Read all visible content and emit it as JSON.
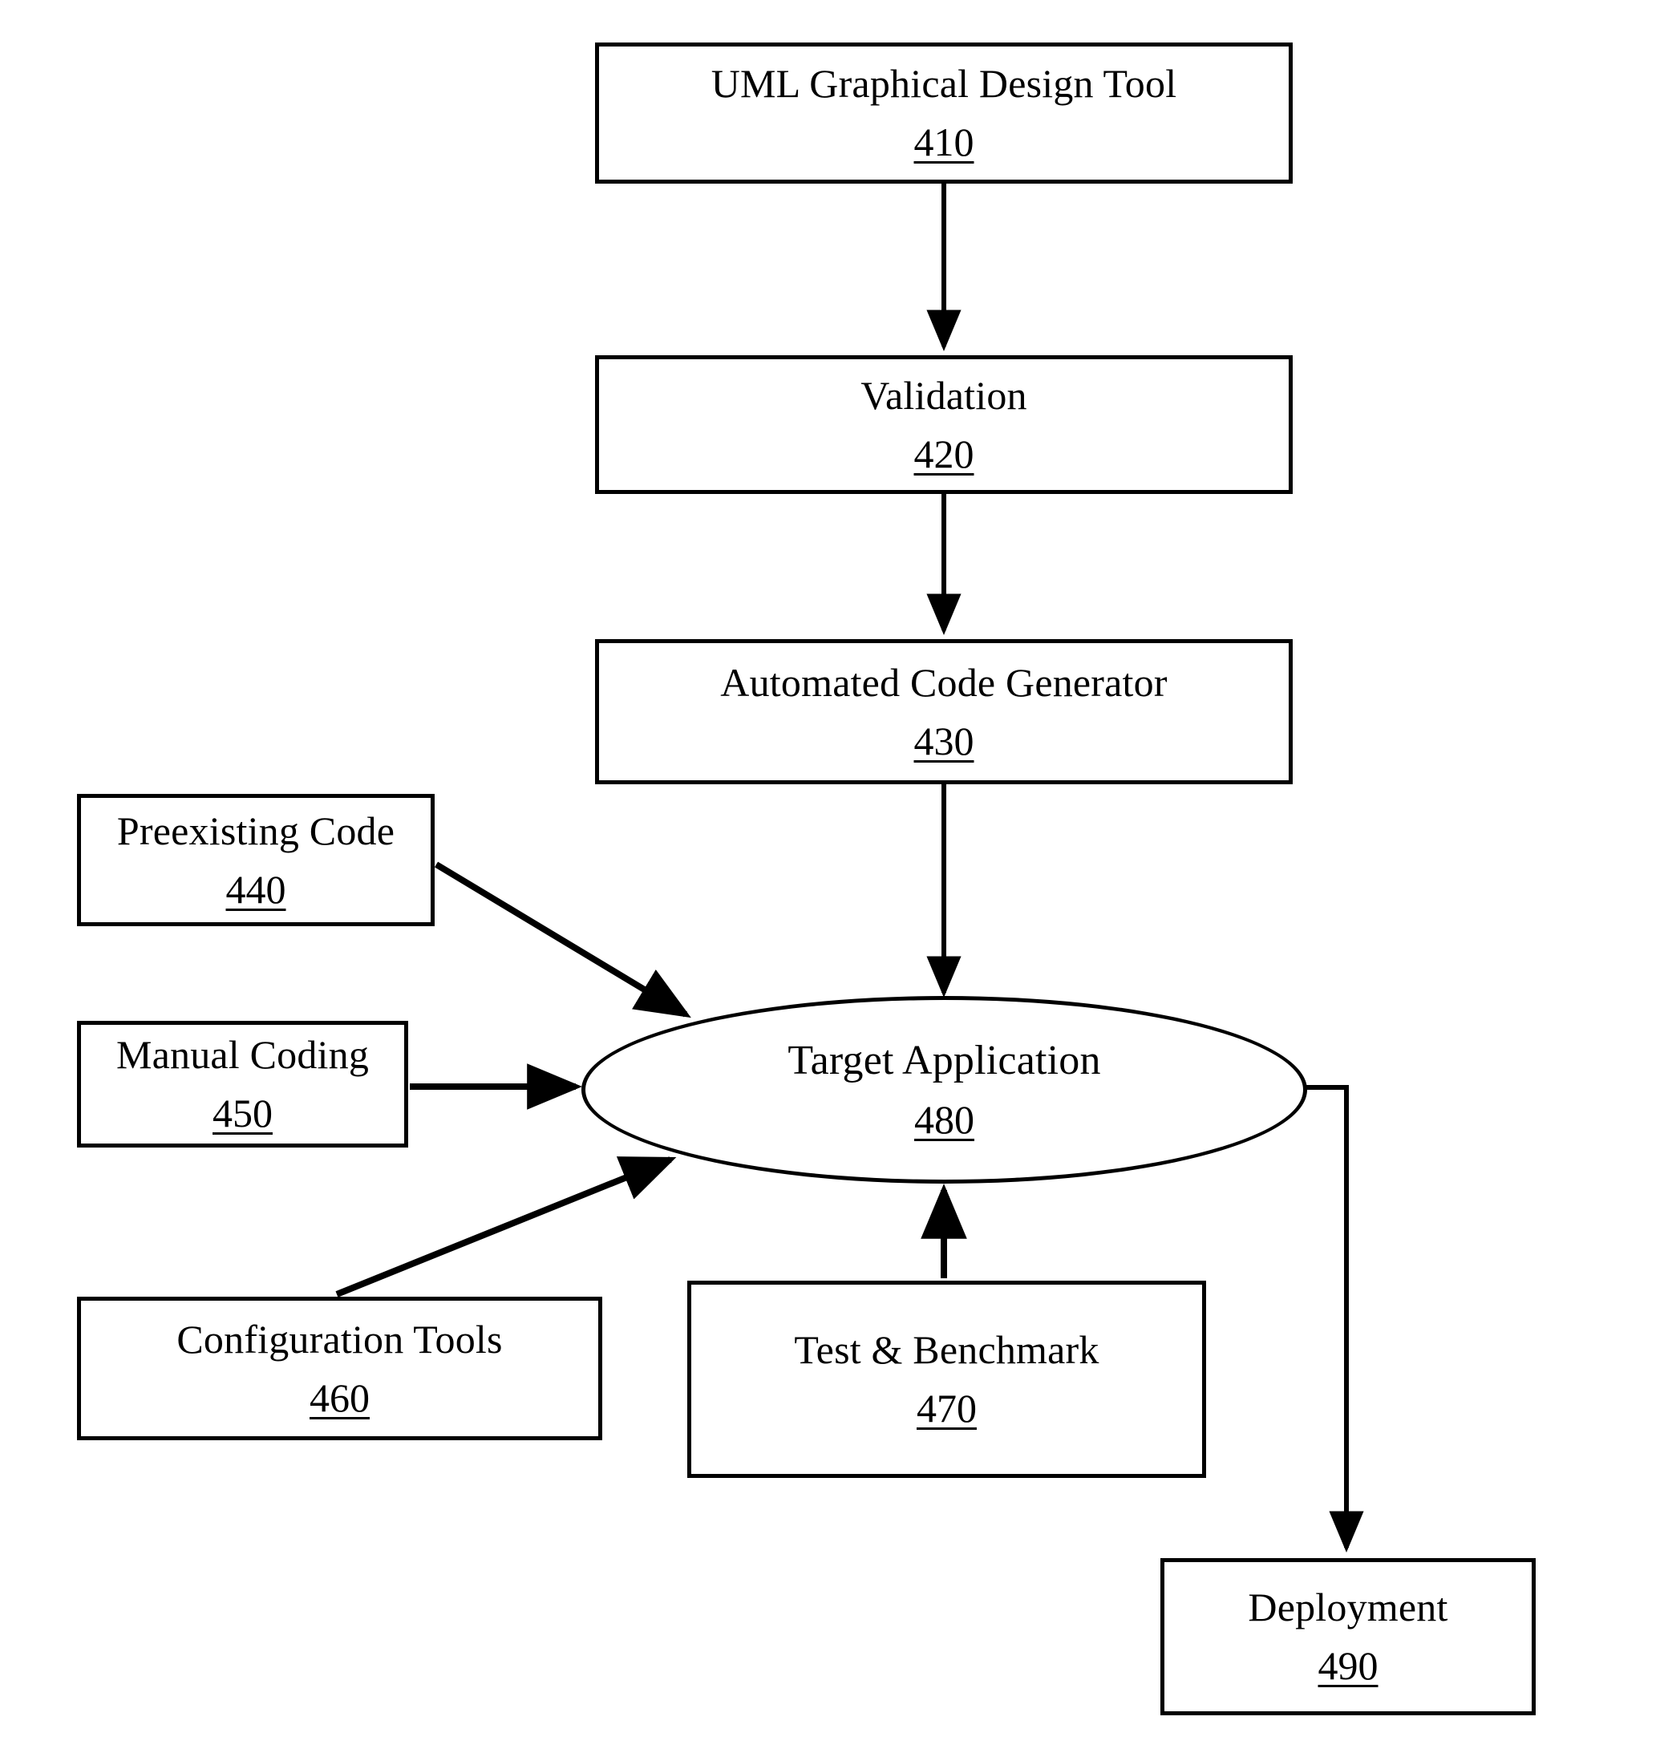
{
  "figure": {
    "title": "Software development toolchain flow diagram",
    "stroke_color": "#000000",
    "background_color": "#ffffff"
  },
  "nodes": [
    {
      "id": "410",
      "label": "UML Graphical Design Tool",
      "ref": "410",
      "shape": "rectangle"
    },
    {
      "id": "420",
      "label": "Validation",
      "ref": "420",
      "shape": "rectangle"
    },
    {
      "id": "430",
      "label": "Automated Code Generator",
      "ref": "430",
      "shape": "rectangle"
    },
    {
      "id": "440",
      "label": "Preexisting Code",
      "ref": "440",
      "shape": "rectangle"
    },
    {
      "id": "450",
      "label": "Manual Coding",
      "ref": "450",
      "shape": "rectangle"
    },
    {
      "id": "460",
      "label": "Configuration Tools",
      "ref": "460",
      "shape": "rectangle"
    },
    {
      "id": "470",
      "label": "Test & Benchmark",
      "ref": "470",
      "shape": "rectangle"
    },
    {
      "id": "480",
      "label": "Target Application",
      "ref": "480",
      "shape": "ellipse"
    },
    {
      "id": "490",
      "label": "Deployment",
      "ref": "490",
      "shape": "rectangle"
    }
  ],
  "edges": [
    {
      "from": "410",
      "to": "420",
      "style": "straight-vertical",
      "arrow": "end"
    },
    {
      "from": "420",
      "to": "430",
      "style": "straight-vertical",
      "arrow": "end"
    },
    {
      "from": "430",
      "to": "480",
      "style": "straight-vertical",
      "arrow": "end"
    },
    {
      "from": "440",
      "to": "480",
      "style": "diagonal",
      "arrow": "end"
    },
    {
      "from": "450",
      "to": "480",
      "style": "straight-horizontal",
      "arrow": "end"
    },
    {
      "from": "460",
      "to": "480",
      "style": "diagonal",
      "arrow": "end"
    },
    {
      "from": "470",
      "to": "480",
      "style": "straight-vertical-up",
      "arrow": "end"
    },
    {
      "from": "480",
      "to": "490",
      "style": "elbow",
      "arrow": "end"
    }
  ]
}
